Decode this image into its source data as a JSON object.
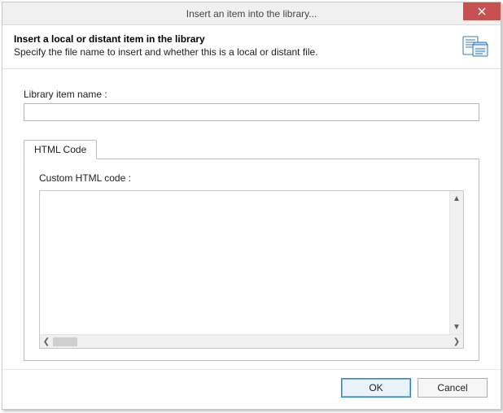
{
  "window": {
    "title": "Insert an item into the library..."
  },
  "header": {
    "heading": "Insert a local or distant item in the library",
    "subtext": "Specify the file name to insert and whether this is a local or distant file."
  },
  "fields": {
    "library_item_name": {
      "label": "Library item name :",
      "value": ""
    }
  },
  "tabs": {
    "html_code": {
      "label": "HTML Code",
      "inner_label": "Custom HTML code :",
      "value": ""
    }
  },
  "buttons": {
    "ok": "OK",
    "cancel": "Cancel"
  },
  "icons": {
    "close": "close-icon",
    "header": "library-document-icon"
  }
}
